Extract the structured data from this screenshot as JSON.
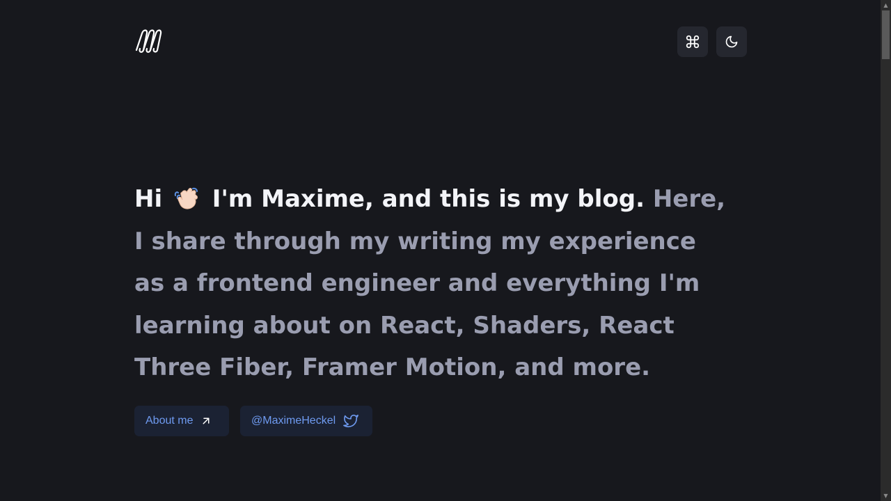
{
  "header": {
    "logo_icon": "mh-logo-icon",
    "command_button_icon": "command-icon",
    "theme_button_icon": "moon-icon"
  },
  "hero": {
    "greeting": "Hi",
    "wave_emoji": "waving-hand-icon",
    "intro": "I'm Maxime, and this is my blog.",
    "description": "Here, I share through my writing my experience as a frontend engineer and everything I'm learning about on React, Shaders, React Three Fiber, Framer Motion, and more."
  },
  "links": {
    "about_label": "About me",
    "about_icon": "arrow-up-right-icon",
    "twitter_label": "@MaximeHeckel",
    "twitter_icon": "twitter-icon"
  },
  "colors": {
    "background": "#17181d",
    "heading_highlight": "#f3f4f8",
    "heading_muted": "#9a9db0",
    "button_bg": "#25272f",
    "link_bg": "#1b2233",
    "link_text": "#6f9bf1"
  }
}
